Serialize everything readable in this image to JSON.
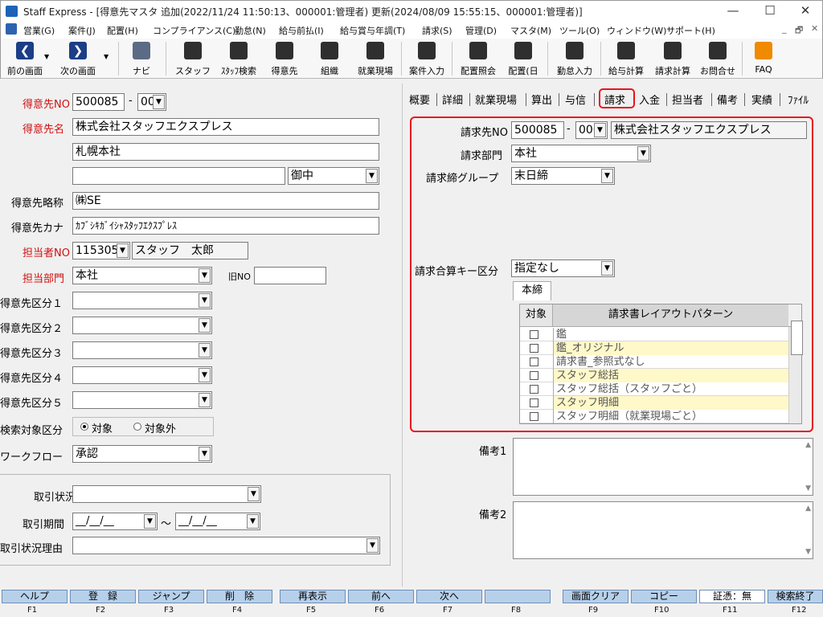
{
  "window": {
    "title": "Staff Express - [得意先マスタ 追加(2022/11/24 11:50:13、000001:管理者) 更新(2024/08/09 15:55:15、000001:管理者)]",
    "min": "—",
    "max": "☐",
    "close": "✕"
  },
  "menu": {
    "items": [
      "営業(G)",
      "案件(J)",
      "配置(H)",
      "コンプライアンス(C)",
      "勤怠(N)",
      "給与前払(I)",
      "給与賞与年調(T)",
      "請求(S)",
      "管理(D)",
      "マスタ(M)",
      "ツール(O)",
      "ウィンドウ(W)",
      "サポート(H)"
    ],
    "mdi_min": "_",
    "mdi_restore": "🗗",
    "mdi_close": "✕"
  },
  "toolbar": {
    "prev": "前の画面",
    "next": "次の画面",
    "navi": "ナビ",
    "staff": "スタッフ",
    "staff_search": "ｽﾀｯﾌ検索",
    "customer": "得意先",
    "org": "組織",
    "workplace": "就業現場",
    "project_input": "案件入力",
    "placement_inquiry": "配置照会",
    "placement_day": "配置(日",
    "attendance_input": "勤怠入力",
    "salary_calc": "給与計算",
    "invoice_calc": "請求計算",
    "contact": "お問合せ",
    "faq": "FAQ"
  },
  "left": {
    "customer_no_label": "得意先NO",
    "customer_no": "500085",
    "customer_no_dash": "-",
    "customer_sub": "000",
    "customer_name_label": "得意先名",
    "customer_name": "株式会社スタッフエクスプレス",
    "customer_name2": "札幌本社",
    "honorific": "御中",
    "short_label": "得意先略称",
    "short_name": "㈱SE",
    "kana_label": "得意先カナ",
    "kana": "ｶﾌﾞｼｷｶﾞｲｼｬｽﾀｯﾌｴｸｽﾌﾟﾚｽ",
    "staff_no_label": "担当者NO",
    "staff_no": "115305",
    "staff_name": "スタッフ　太郎",
    "dept_label": "担当部門",
    "dept": "本社",
    "old_no_label": "旧NO",
    "cat1": "得意先区分１",
    "cat2": "得意先区分２",
    "cat3": "得意先区分３",
    "cat4": "得意先区分４",
    "cat5": "得意先区分５",
    "search_label": "検索対象区分",
    "search_on": "対象",
    "search_off": "対象外",
    "workflow_label": "ワークフロー",
    "workflow": "承認",
    "trade_status_label": "取引状況",
    "trade_period_label": "取引期間",
    "trade_from": "__/__/__",
    "trade_tilde": "～",
    "trade_to": "__/__/__",
    "trade_reason_label": "取引状況理由"
  },
  "tabs": [
    "概要",
    "詳細",
    "就業現場",
    "算出",
    "与信",
    "請求",
    "入金",
    "担当者",
    "備考",
    "実績",
    "ﾌｧｲﾙ"
  ],
  "billing": {
    "billing_no_label": "請求先NO",
    "billing_no": "500085",
    "billing_dash": "-",
    "billing_sub": "000",
    "billing_name": "株式会社スタッフエクスプレス",
    "billing_dept_label": "請求部門",
    "billing_dept": "本社",
    "closing_group_label": "請求締グループ",
    "closing_group": "末日締",
    "merge_key_label": "請求合算キー区分",
    "merge_key": "指定なし",
    "subtab": "本締",
    "grid_col1": "対象",
    "grid_col2": "請求書レイアウトパターン",
    "rows": [
      {
        "name": "鑑"
      },
      {
        "name": "鑑_オリジナル"
      },
      {
        "name": "請求書_参照式なし"
      },
      {
        "name": "スタッフ総括"
      },
      {
        "name": "スタッフ総括（スタッフごと）"
      },
      {
        "name": "スタッフ明細"
      },
      {
        "name": "スタッフ明細（就業現場ごと）"
      }
    ]
  },
  "memo": {
    "label1": "備考1",
    "label2": "備考2",
    "up": "▲",
    "down": "▼"
  },
  "fkeys": [
    {
      "label": "ヘルプ",
      "key": "F1"
    },
    {
      "label": "登　録",
      "key": "F2"
    },
    {
      "label": "ジャンプ",
      "key": "F3"
    },
    {
      "label": "削　除",
      "key": "F4"
    },
    {
      "label": "再表示",
      "key": "F5"
    },
    {
      "label": "前へ",
      "key": "F6"
    },
    {
      "label": "次へ",
      "key": "F7"
    },
    {
      "label": "",
      "key": "F8"
    },
    {
      "label": "画面クリア",
      "key": "F9"
    },
    {
      "label": "コピー",
      "key": "F10"
    },
    {
      "label": "証憑：無",
      "key": "F11"
    },
    {
      "label": "検索終了",
      "key": "F12"
    }
  ],
  "colors": {
    "accent_red": "#e8141e",
    "fkey_blue": "#b7d0ea",
    "row_yellow": "#fff8c8",
    "required_red": "#d01010"
  }
}
